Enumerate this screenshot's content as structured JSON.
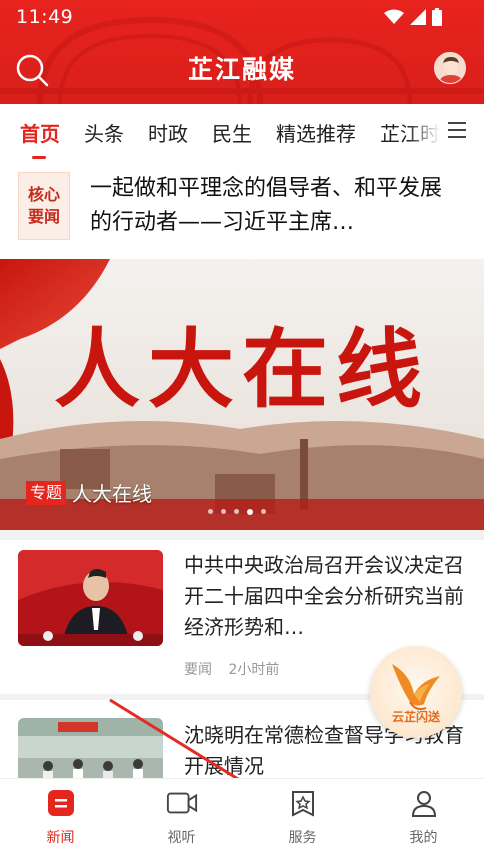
{
  "status_bar": {
    "time": "11:49"
  },
  "header": {
    "title": "芷江融媒"
  },
  "tabs": [
    {
      "label": "首页",
      "active": true
    },
    {
      "label": "头条"
    },
    {
      "label": "时政"
    },
    {
      "label": "民生"
    },
    {
      "label": "精选推荐"
    },
    {
      "label": "芷江时"
    }
  ],
  "core_news": {
    "badge_line1": "核心",
    "badge_line2": "要闻",
    "title": "一起做和平理念的倡导者、和平发展的行动者——习近平主席…"
  },
  "banner": {
    "calligraphy": "人大在线",
    "tag": "专题",
    "title": "人大在线",
    "dots": 5,
    "active_dot": 4
  },
  "news": [
    {
      "title": "中共中央政治局召开会议决定召开二十届四中全会分析研究当前经济形势和…",
      "source": "要闻",
      "time": "2小时前"
    },
    {
      "title": "沈晓明在常德检查督导学习教育开展情况"
    }
  ],
  "float_badge": {
    "label": "云芷闪送"
  },
  "bottom_nav": [
    {
      "label": "新闻",
      "icon": "news-icon",
      "active": true
    },
    {
      "label": "视听",
      "icon": "video-icon"
    },
    {
      "label": "服务",
      "icon": "service-icon"
    },
    {
      "label": "我的",
      "icon": "profile-icon"
    }
  ],
  "colors": {
    "brand_red": "#e4261f",
    "header_red": "#e8231e",
    "arrow_red": "#e52b25"
  }
}
